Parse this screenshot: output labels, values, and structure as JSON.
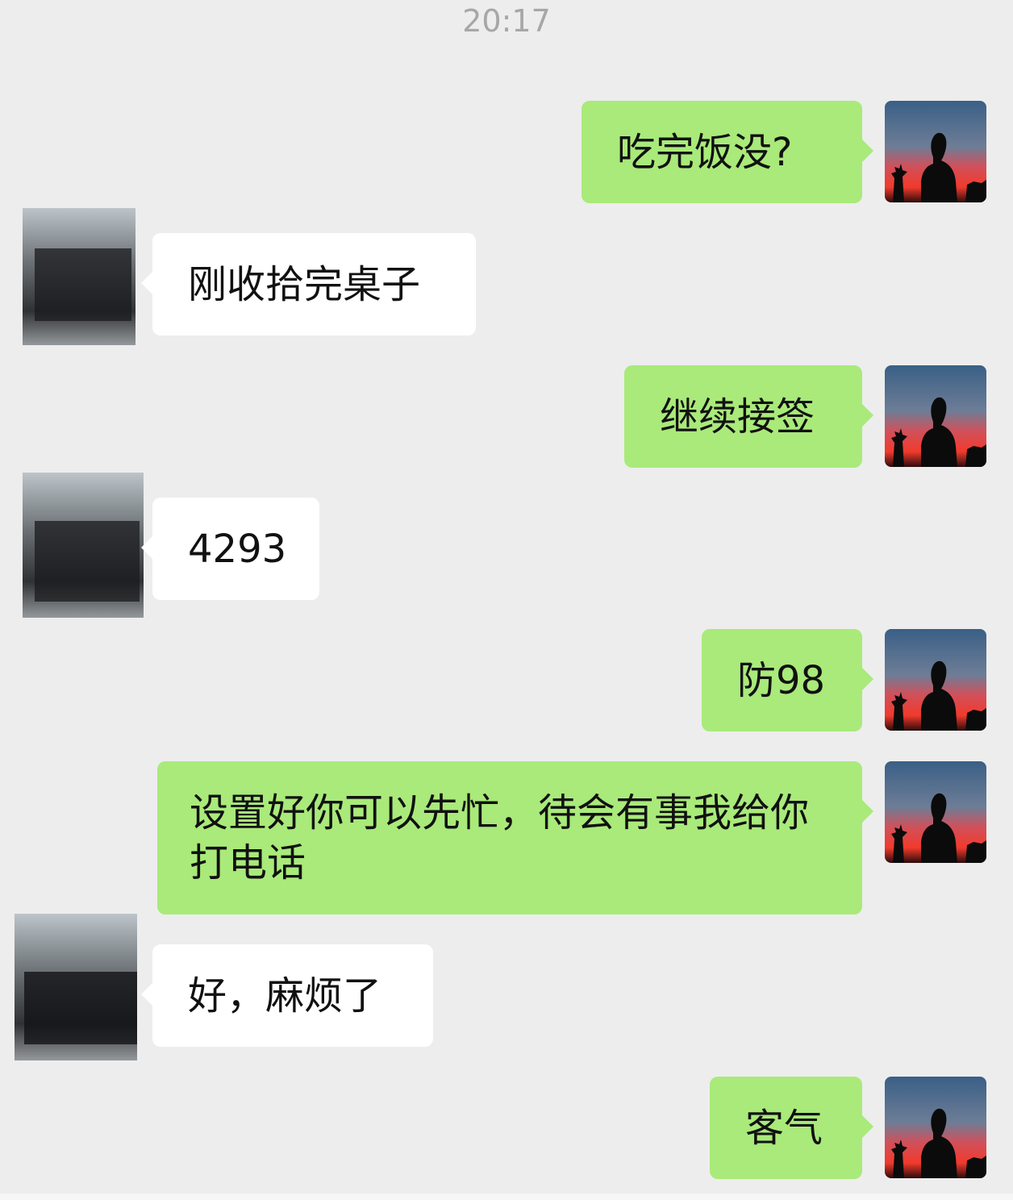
{
  "chat": {
    "timestamp": "20:17",
    "messages": [
      {
        "side": "out",
        "text": "吃完饭没?"
      },
      {
        "side": "in",
        "text": "刚收拾完桌子"
      },
      {
        "side": "out",
        "text": "继续接签"
      },
      {
        "side": "in",
        "text": "4293"
      },
      {
        "side": "out",
        "text": "防98"
      },
      {
        "side": "out",
        "text": "设置好你可以先忙，待会有事我给你打电话"
      },
      {
        "side": "in",
        "text": "好，麻烦了"
      },
      {
        "side": "out",
        "text": "客气"
      }
    ]
  },
  "colors": {
    "background": "#ededed",
    "outgoing_bubble": "#a9ea7a",
    "incoming_bubble": "#ffffff"
  },
  "icons": {
    "self_avatar": "sunset-silhouette-avatar-icon",
    "peer_avatar": "blurred-avatar-icon"
  }
}
